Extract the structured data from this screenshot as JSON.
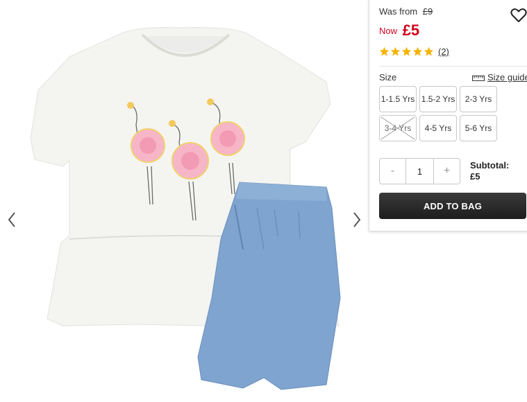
{
  "product": {
    "image_alt": "Flamingo t-shirt and chambray shorts outfit",
    "gallery_prev_icon": "chevron-left-icon",
    "gallery_next_icon": "chevron-right-icon"
  },
  "price": {
    "was_label": "Was from",
    "was_value": "£9",
    "now_label": "Now",
    "now_value": "£5",
    "sale_color": "#d0021b"
  },
  "wishlist": {
    "icon": "heart-icon"
  },
  "rating": {
    "stars": 5,
    "max_stars": 5,
    "star_color": "#f5b400",
    "count_label": "(2)"
  },
  "size": {
    "label": "Size",
    "guide_label": "Size guide",
    "guide_icon": "ruler-icon",
    "options": [
      {
        "label": "1-1.5 Yrs",
        "available": true
      },
      {
        "label": "1.5-2 Yrs",
        "available": true
      },
      {
        "label": "2-3 Yrs",
        "available": true
      },
      {
        "label": "3-4 Yrs",
        "available": false
      },
      {
        "label": "4-5 Yrs",
        "available": true
      },
      {
        "label": "5-6 Yrs",
        "available": true
      }
    ]
  },
  "quantity": {
    "minus": "-",
    "value": "1",
    "plus": "+"
  },
  "subtotal": {
    "label": "Subtotal:",
    "value": "£5"
  },
  "cart": {
    "add_label": "ADD TO BAG"
  }
}
